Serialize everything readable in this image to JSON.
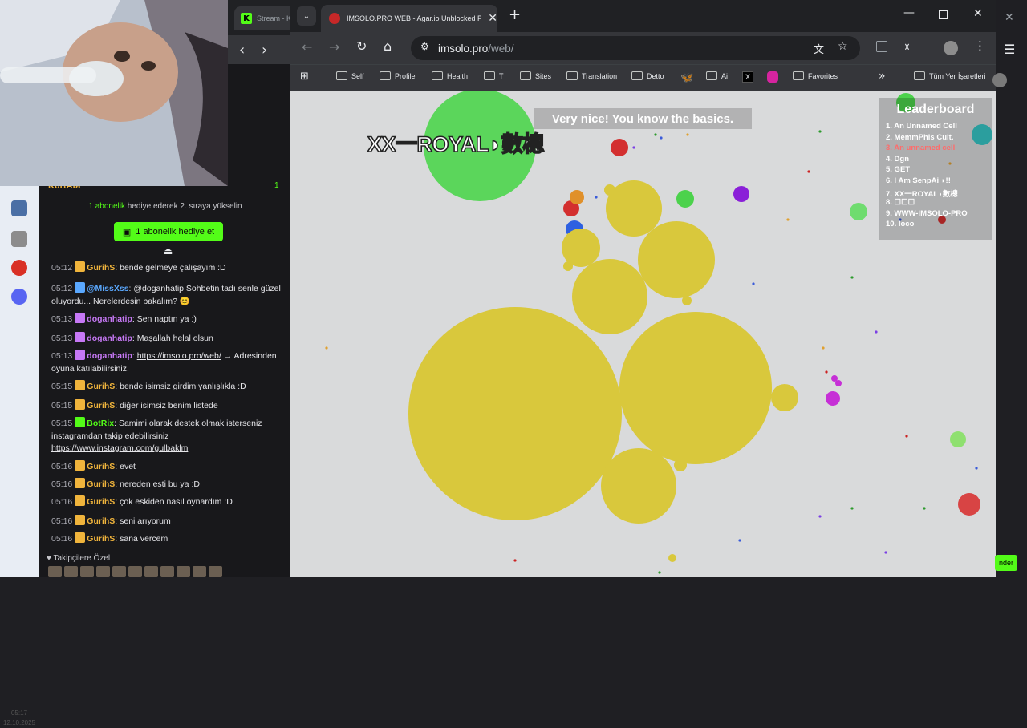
{
  "background_window": {
    "tab_label": "Stream - K",
    "chat": {
      "username_top": "KurtAta",
      "promo_bold": "1 abonelik",
      "promo_rest": "hediye ederek 2. sıraya yükselin",
      "gift_button": "1 abonelik hediye et",
      "messages": [
        {
          "time": "05:12",
          "user": "GurihS",
          "text": ": bende gelmeye çalışayım :D",
          "color": "#f0b43c"
        },
        {
          "time": "05:12",
          "user": "@MissXss",
          "text": ": @doganhatip Sohbetin tadı senle güzel oluyordu... Nerelerdesin bakalım? 😊",
          "color": "#5aa8ff"
        },
        {
          "time": "05:13",
          "user": "doganhatip",
          "text": ": Sen naptın ya :)",
          "color": "#c678f5"
        },
        {
          "time": "05:13",
          "user": "doganhatip",
          "text": ": Maşallah helal olsun",
          "color": "#c678f5"
        },
        {
          "time": "05:13",
          "user": "doganhatip",
          "text": ": ",
          "link": "https://imsolo.pro/web/",
          "after": " → Adresinden oyuna katılabilirsiniz.",
          "color": "#c678f5"
        },
        {
          "time": "05:15",
          "user": "GurihS",
          "text": ": bende isimsiz girdim yanlışlıkla :D",
          "color": "#f0b43c"
        },
        {
          "time": "05:15",
          "user": "GurihS",
          "text": ": diğer isimsiz benim listede",
          "color": "#f0b43c"
        },
        {
          "time": "05:15",
          "user": "BotRix",
          "text": ": Samimi olarak destek olmak isterseniz instagramdan takip edebilirsiniz ",
          "link": "https://www.instagram.com/gulbaklm",
          "color": "#53fc18"
        },
        {
          "time": "05:16",
          "user": "GurihS",
          "text": ": evet",
          "color": "#f0b43c"
        },
        {
          "time": "05:16",
          "user": "GurihS",
          "text": ": nereden esti bu ya :D",
          "color": "#f0b43c"
        },
        {
          "time": "05:16",
          "user": "GurihS",
          "text": ": çok eskiden nasıl oynardım :D",
          "color": "#f0b43c"
        },
        {
          "time": "05:16",
          "user": "GurihS",
          "text": ": seni arıyorum",
          "color": "#f0b43c"
        },
        {
          "time": "05:16",
          "user": "GurihS",
          "text": ": sana vercem",
          "color": "#f0b43c"
        }
      ],
      "follower_label": "♥ Takipçilere Özel"
    },
    "taskbar_time": "05:17",
    "taskbar_date": "12.10.2025"
  },
  "browser": {
    "tab_title": "IMSOLO.PRO WEB - Agar.io Unblocked Pr",
    "url_host": "imsolo.pro",
    "url_path": "/web/",
    "bookmarks": [
      "Self",
      "Profile",
      "Health",
      "T",
      "Sites",
      "Translation",
      "Detto",
      "Ai",
      "Favorites"
    ],
    "all_bookmarks": "Tüm Yer İşaretleri",
    "icons": [
      "back-icon",
      "forward-icon",
      "reload-icon",
      "home-icon",
      "translate-icon",
      "star-icon",
      "extensions-icon",
      "menu-icon"
    ]
  },
  "game": {
    "toast": "Very nice! You know the basics.",
    "player_name": "XX一ROYAL◗數樬",
    "leaderboard_title": "Leaderboard",
    "leaderboard": [
      {
        "rank": "1. An Unnamed Cell",
        "color": "#ffffff"
      },
      {
        "rank": "2. MemmPhis Cult.",
        "color": "#ffffff"
      },
      {
        "rank": "3. An unnamed cell",
        "color": "#ff6b6b"
      },
      {
        "rank": "4. Dgn",
        "color": "#ffffff"
      },
      {
        "rank": "5. GET",
        "color": "#ffffff"
      },
      {
        "rank": "6. I Am SenpAi ◗!!",
        "color": "#ffffff"
      },
      {
        "rank": "7. XX一ROYAL◗數樬",
        "color": "#ffffff"
      },
      {
        "rank": "8. ☐☐☐",
        "color": "#ffffff"
      },
      {
        "rank": "9. WWW-IMSOLO-PRO",
        "color": "#ffffff"
      },
      {
        "rank": "10. loco",
        "color": "#ffffff"
      }
    ]
  },
  "right_strip": {
    "button": "nder"
  }
}
